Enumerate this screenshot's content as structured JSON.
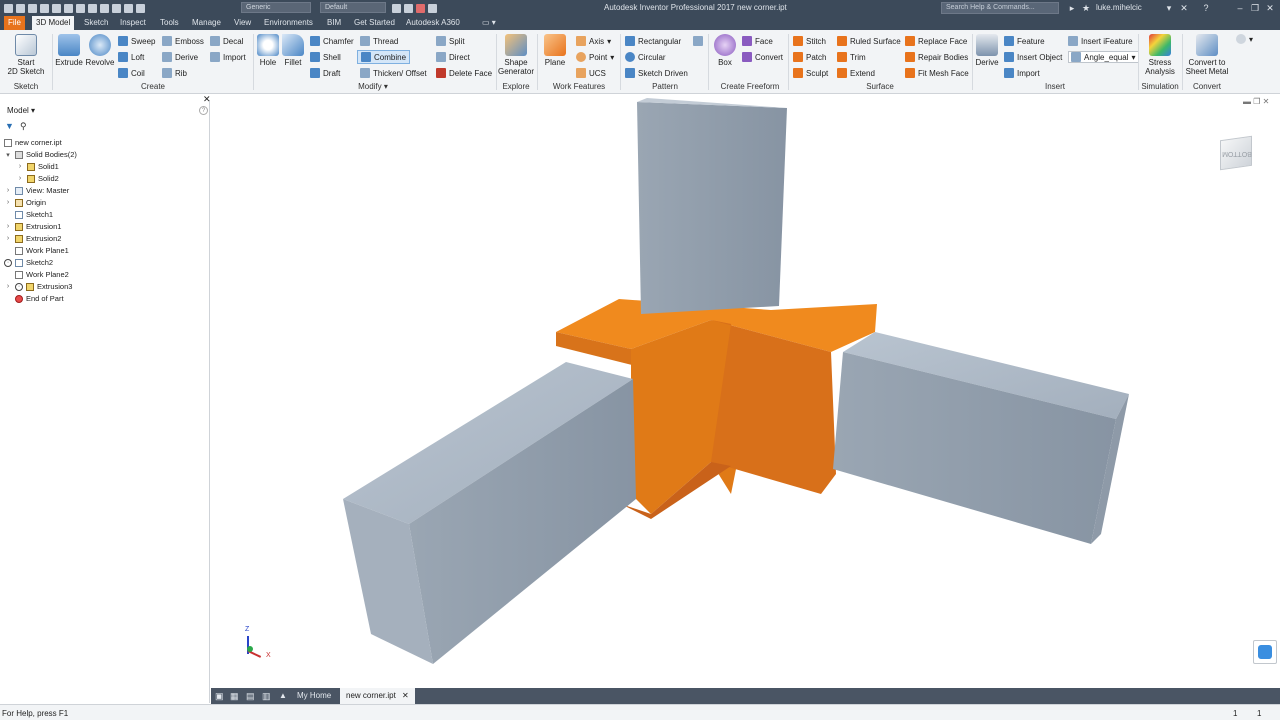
{
  "app": {
    "title": "Autodesk Inventor Professional 2017    new corner.ipt",
    "material_select": "Generic",
    "appearance_select": "Default",
    "search_placeholder": "Search Help & Commands...",
    "user": "luke.mihelcic"
  },
  "menu_tabs": [
    {
      "label": "File"
    },
    {
      "label": "3D Model"
    },
    {
      "label": "Sketch"
    },
    {
      "label": "Inspect"
    },
    {
      "label": "Tools"
    },
    {
      "label": "Manage"
    },
    {
      "label": "View"
    },
    {
      "label": "Environments"
    },
    {
      "label": "BIM"
    },
    {
      "label": "Get Started"
    },
    {
      "label": "Autodesk A360"
    }
  ],
  "ribbon": {
    "sketch": {
      "start": "Start\n2D Sketch",
      "group": "Sketch"
    },
    "create": {
      "extrude": "Extrude",
      "revolve": "Revolve",
      "sweep": "Sweep",
      "loft": "Loft",
      "coil": "Coil",
      "emboss": "Emboss",
      "derive": "Derive",
      "rib": "Rib",
      "decal": "Decal",
      "import": "Import",
      "group": "Create"
    },
    "modify": {
      "hole": "Hole",
      "fillet": "Fillet",
      "chamfer": "Chamfer",
      "shell": "Shell",
      "draft": "Draft",
      "thread": "Thread",
      "combine": "Combine",
      "thicken": "Thicken/ Offset",
      "split": "Split",
      "direct": "Direct",
      "delete_face": "Delete Face",
      "group": "Modify"
    },
    "explore": {
      "shape_generator": "Shape\nGenerator",
      "group": "Explore"
    },
    "work_features": {
      "plane": "Plane",
      "axis": "Axis",
      "point": "Point",
      "ucs": "UCS",
      "group": "Work Features"
    },
    "pattern": {
      "rectangular": "Rectangular",
      "circular": "Circular",
      "sketch_driven": "Sketch Driven",
      "group": "Pattern"
    },
    "freeform": {
      "box": "Box",
      "face": "Face",
      "convert": "Convert",
      "group": "Create Freeform"
    },
    "surface": {
      "stitch": "Stitch",
      "patch": "Patch",
      "sculpt": "Sculpt",
      "ruled_surface": "Ruled Surface",
      "trim": "Trim",
      "extend": "Extend",
      "replace_face": "Replace Face",
      "repair_bodies": "Repair Bodies",
      "fit_mesh_face": "Fit Mesh Face",
      "group": "Surface"
    },
    "insert": {
      "derive": "Derive",
      "feature": "Feature",
      "insert_object": "Insert Object",
      "import": "Import",
      "insert_ifeature": "Insert iFeature",
      "angle_param": "Angle_equal",
      "group": "Insert"
    },
    "simulation": {
      "stress": "Stress\nAnalysis",
      "group": "Simulation"
    },
    "convert": {
      "sheet_metal": "Convert to\nSheet Metal",
      "group": "Convert"
    }
  },
  "browser": {
    "title": "Model",
    "items": [
      {
        "label": "new corner.ipt"
      },
      {
        "label": "Solid Bodies(2)"
      },
      {
        "label": "Solid1"
      },
      {
        "label": "Solid2"
      },
      {
        "label": "View: Master"
      },
      {
        "label": "Origin"
      },
      {
        "label": "Sketch1"
      },
      {
        "label": "Extrusion1"
      },
      {
        "label": "Extrusion2"
      },
      {
        "label": "Work Plane1"
      },
      {
        "label": "Sketch2"
      },
      {
        "label": "Work Plane2"
      },
      {
        "label": "Extrusion3"
      },
      {
        "label": "End of Part"
      }
    ]
  },
  "viewcube": {
    "face_label": "BOTTOM"
  },
  "axes": {
    "z": "Z",
    "x": "X"
  },
  "doc_tabs": [
    {
      "label": "My Home"
    },
    {
      "label": "new corner.ipt"
    }
  ],
  "status": {
    "text": "For Help, press F1",
    "count_a": "1",
    "count_b": "1"
  },
  "colors": {
    "orange_body": "#e8821e",
    "gray_body": "#9aa6b3",
    "titlebar": "#3c4a5a"
  }
}
